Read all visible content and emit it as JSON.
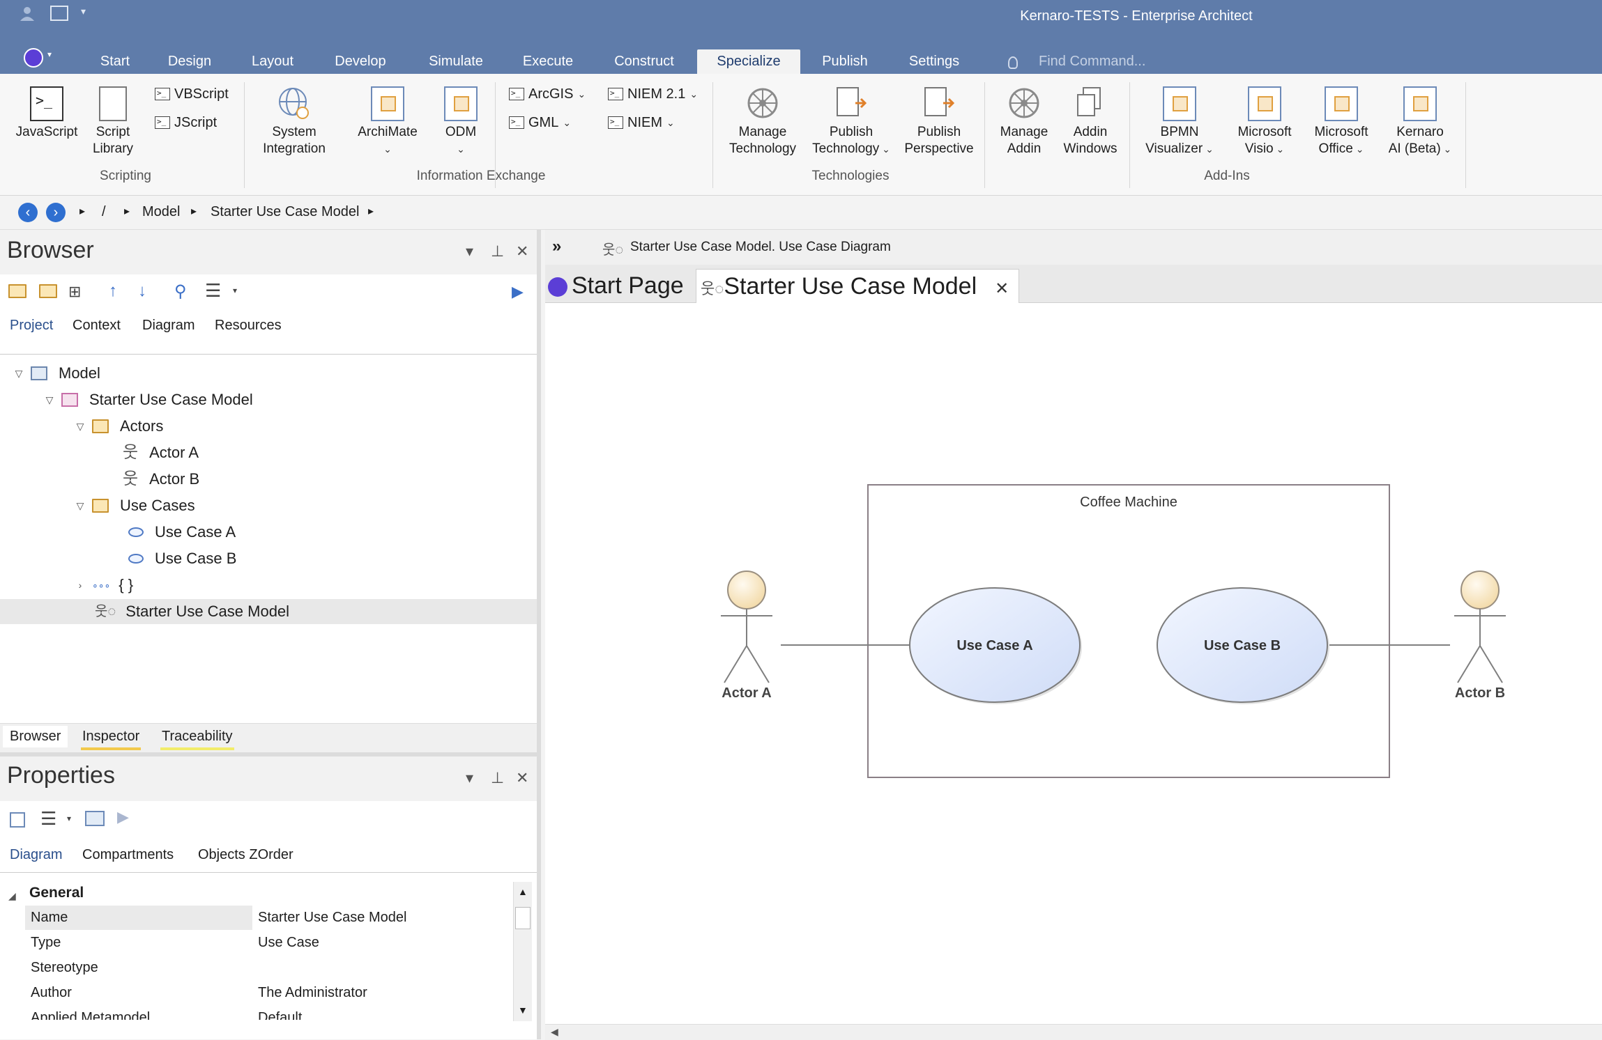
{
  "window": {
    "title": "Kernaro-TESTS - Enterprise Architect"
  },
  "menu": {
    "items": [
      "Start",
      "Design",
      "Layout",
      "Develop",
      "Simulate",
      "Execute",
      "Construct",
      "Specialize",
      "Publish",
      "Settings"
    ],
    "active": "Specialize",
    "find_placeholder": "Find Command..."
  },
  "ribbon": {
    "scripting": {
      "javascript": "JavaScript",
      "script_library_1": "Script",
      "script_library_2": "Library",
      "vbscript": "VBScript",
      "jscript": "JScript",
      "label": "Scripting"
    },
    "info_exchange": {
      "system_integration_1": "System",
      "system_integration_2": "Integration",
      "archimate": "ArchiMate",
      "odm": "ODM",
      "arcgis": "ArcGIS",
      "gml": "GML",
      "niem21": "NIEM 2.1",
      "niem": "NIEM",
      "label": "Information Exchange"
    },
    "technologies": {
      "manage_1": "Manage",
      "manage_2": "Technology",
      "publish_1": "Publish",
      "publish_2": "Technology",
      "perspective_1": "Publish",
      "perspective_2": "Perspective",
      "label": "Technologies"
    },
    "addins": {
      "manage_1": "Manage",
      "manage_2": "Addin",
      "windows_1": "Addin",
      "windows_2": "Windows",
      "bpmn_1": "BPMN",
      "bpmn_2": "Visualizer",
      "visio_1": "Microsoft",
      "visio_2": "Visio",
      "office_1": "Microsoft",
      "office_2": "Office",
      "kernaro_1": "Kernaro",
      "kernaro_2": "AI (Beta)",
      "label": "Add-Ins"
    }
  },
  "breadcrumb": {
    "root": "/",
    "items": [
      "Model",
      "Starter Use Case Model"
    ]
  },
  "browser": {
    "title": "Browser",
    "tabs": [
      "Project",
      "Context",
      "Diagram",
      "Resources"
    ],
    "tree": [
      {
        "label": "Model"
      },
      {
        "label": "Starter Use Case Model"
      },
      {
        "label": "Actors"
      },
      {
        "label": "Actor A"
      },
      {
        "label": "Actor B"
      },
      {
        "label": "Use Cases"
      },
      {
        "label": "Use Case A"
      },
      {
        "label": "Use Case B"
      },
      {
        "label": "{ }"
      },
      {
        "label": "Starter Use Case Model"
      }
    ],
    "bottom_tabs": [
      "Browser",
      "Inspector",
      "Traceability"
    ]
  },
  "properties": {
    "title": "Properties",
    "tabs": [
      "Diagram",
      "Compartments",
      "Objects ZOrder"
    ],
    "section": "General",
    "rows": [
      {
        "key": "Name",
        "value": "Starter Use Case Model"
      },
      {
        "key": "Type",
        "value": "Use Case"
      },
      {
        "key": "Stereotype",
        "value": ""
      },
      {
        "key": "Author",
        "value": "The Administrator"
      },
      {
        "key": "Applied Metamodel",
        "value": "Default"
      }
    ]
  },
  "diagram": {
    "header": "Starter Use Case Model.  Use Case Diagram",
    "tabs": [
      "Start Page",
      "Starter Use Case Model"
    ],
    "boundary": "Coffee Machine",
    "actors": [
      "Actor A",
      "Actor B"
    ],
    "use_cases": [
      "Use Case A",
      "Use Case B"
    ]
  }
}
